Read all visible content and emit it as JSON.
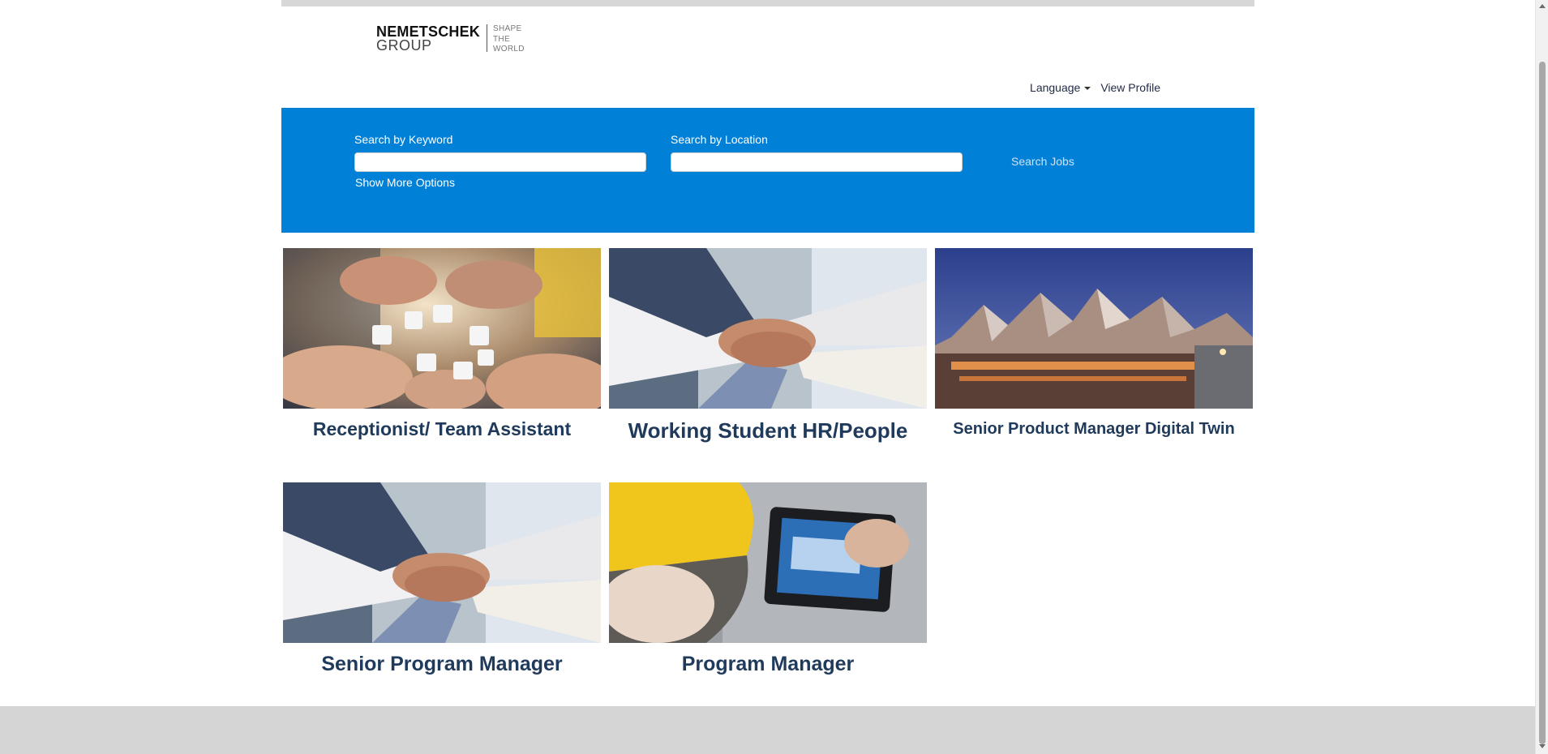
{
  "header": {
    "logo": {
      "line1": "NEMETSCHEK",
      "line2": "GROUP",
      "tagline": [
        "SHAPE",
        "THE",
        "WORLD"
      ]
    },
    "language_label": "Language",
    "view_profile_label": "View Profile"
  },
  "search": {
    "keyword_label": "Search by Keyword",
    "keyword_value": "",
    "location_label": "Search by Location",
    "location_value": "",
    "search_button_label": "Search Jobs",
    "more_options_label": "Show More Options"
  },
  "tiles": [
    {
      "title": "Receptionist/ Team Assistant",
      "image": "puzzle-hands"
    },
    {
      "title": "Working Student HR/People",
      "image": "stacked-hands"
    },
    {
      "title": "Senior Product Manager Digital Twin",
      "image": "building-dusk"
    },
    {
      "title": "Senior Program Manager",
      "image": "stacked-hands"
    },
    {
      "title": "Program Manager",
      "image": "hardhat-tablet"
    }
  ],
  "colors": {
    "banner": "#0080d7",
    "tile_title": "#1f3a5a",
    "footer": "#d5d5d5"
  }
}
